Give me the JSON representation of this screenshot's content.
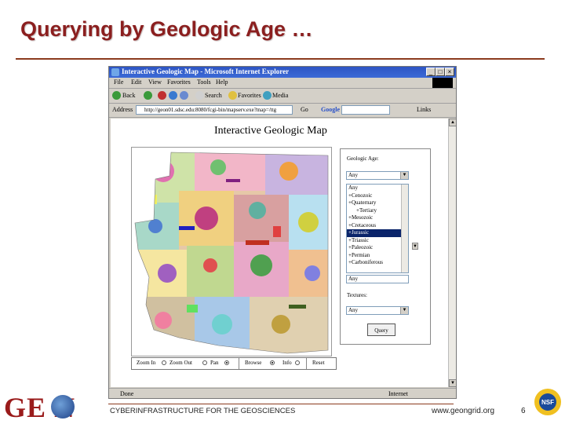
{
  "slide": {
    "title": "Querying by Geologic Age …",
    "footer_text": "CYBERINFRASTRUCTURE FOR THE GEOSCIENCES",
    "footer_url": "www.geongrid.org",
    "page_number": "6",
    "logo_text": "GE N",
    "nsf_text": "NSF"
  },
  "browser": {
    "window_title": "Interactive Geologic Map - Microsoft Internet Explorer",
    "menu": [
      "File",
      "Edit",
      "View",
      "Favorites",
      "Tools",
      "Help"
    ],
    "toolbar": {
      "back": "Back",
      "search": "Search",
      "favorites": "Favorites",
      "media": "Media"
    },
    "address_label": "Address",
    "address_value": "http://geon01.sdsc.edu:8080/fcgi-bin/mapserv.exe?map=/ttg",
    "go_label": "Go",
    "google_label": "Google",
    "links_label": "Links",
    "status_left": "Done",
    "status_right": "Internet"
  },
  "page": {
    "heading": "Interactive Geologic Map",
    "geologic_age_label": "Geologic Age:",
    "age_select_value": "Any",
    "age_list": [
      "Any",
      "+Cenozoic",
      "+Quaternary",
      "+Tertiary",
      "+Mesozoic",
      "+Cretaceous",
      "+Jurassic",
      "+Triassic",
      "+Paleozoic",
      "+Permian",
      "+Carboniferous"
    ],
    "age_list_selected": "+Jurassic",
    "age_select2_value": "Any",
    "textures_label": "Textures:",
    "textures_value": "Any",
    "query_button": "Query",
    "nav": {
      "zoom_in": "Zoom In",
      "zoom_out": "Zoom Out",
      "pan": "Pan",
      "browse": "Browse",
      "info": "Info",
      "reset": "Reset"
    }
  },
  "colors": {
    "title": "#8b1f1f",
    "rule": "#8b3a1e",
    "selected_item": "#0a246a"
  },
  "icons": [
    "back-icon",
    "forward-icon",
    "stop-icon",
    "refresh-icon",
    "home-icon",
    "search-icon",
    "favorites-icon",
    "media-icon",
    "globe-icon",
    "nsf-seal-icon"
  ]
}
